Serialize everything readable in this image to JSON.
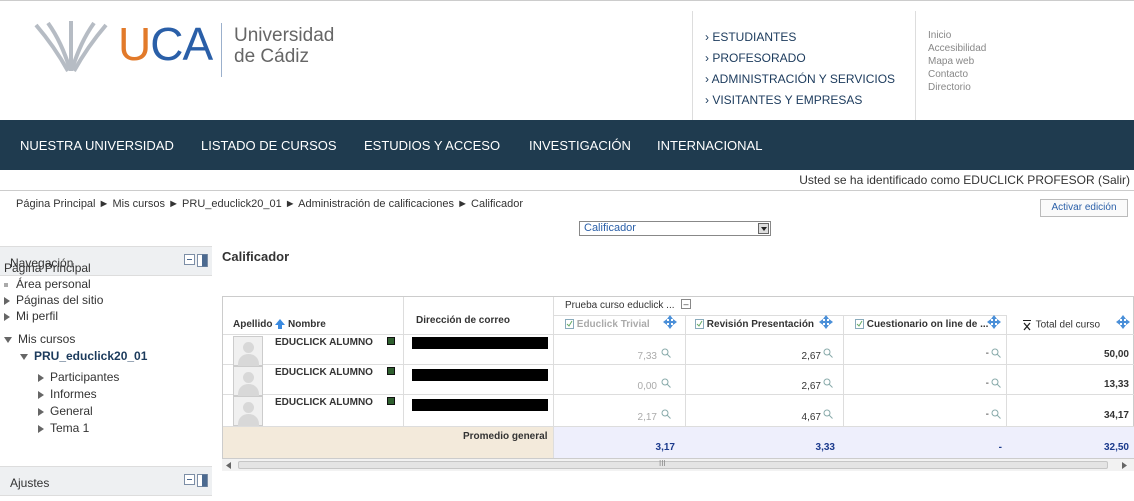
{
  "header": {
    "logo_text": "UCA",
    "university_line1": "Universidad",
    "university_line2": "de Cádiz",
    "audience_links": [
      "› ESTUDIANTES",
      "› PROFESORADO",
      "› ADMINISTRACIÓN Y SERVICIOS",
      "› VISITANTES Y EMPRESAS"
    ],
    "utility_links": [
      "Inicio",
      "Accesibilidad",
      "Mapa web",
      "Contacto",
      "Directorio"
    ]
  },
  "mainnav": [
    "NUESTRA UNIVERSIDAD",
    "LISTADO DE CURSOS",
    "ESTUDIOS Y ACCESO",
    "INVESTIGACIÓN",
    "INTERNACIONAL"
  ],
  "user": {
    "text": "Usted se ha identificado como ",
    "name": "EDUCLICK PROFESOR",
    "logout": " (Salir)"
  },
  "breadcrumb": "Página Principal ► Mis cursos ► PRU_educlick20_01 ► Administración de calificaciones ► Calificador",
  "edit_button": "Activar edición",
  "sidebar": {
    "nav_title": "Navegación",
    "items": [
      "Página Principal",
      "Área personal",
      "Páginas del sitio",
      "Mi perfil",
      "Mis cursos",
      "PRU_educlick20_01",
      "Participantes",
      "Informes",
      "General",
      "Tema 1"
    ],
    "settings_title": "Ajustes"
  },
  "report_select": "Calificador",
  "page_title": "Calificador",
  "grader": {
    "category_header": "Prueba curso educlick ...",
    "collapse_toggle": "–",
    "col_name_a": "Apellido",
    "col_name_b": "Nombre",
    "col_email": "Dirección de correo",
    "items": [
      "Educlick Trivial",
      "Revisión Presentación",
      "Cuestionario on line de ..."
    ],
    "total_label": "Total del curso",
    "students": [
      {
        "name": "EDUCLICK ALUMNO",
        "grades": [
          "7,33",
          "2,67",
          "-"
        ],
        "total": "50,00"
      },
      {
        "name": "EDUCLICK ALUMNO",
        "grades": [
          "0,00",
          "2,67",
          "-"
        ],
        "total": "13,33"
      },
      {
        "name": "EDUCLICK ALUMNO",
        "grades": [
          "2,17",
          "4,67",
          "-"
        ],
        "total": "34,17"
      }
    ],
    "average_label": "Promedio general",
    "averages": [
      "3,17",
      "3,33",
      "-",
      "32,50"
    ]
  },
  "scroll_marker": "III",
  "colors": {
    "accent": "#1f3b4f",
    "link": "#2a5fa8",
    "brand_orange": "#e27a2a"
  }
}
